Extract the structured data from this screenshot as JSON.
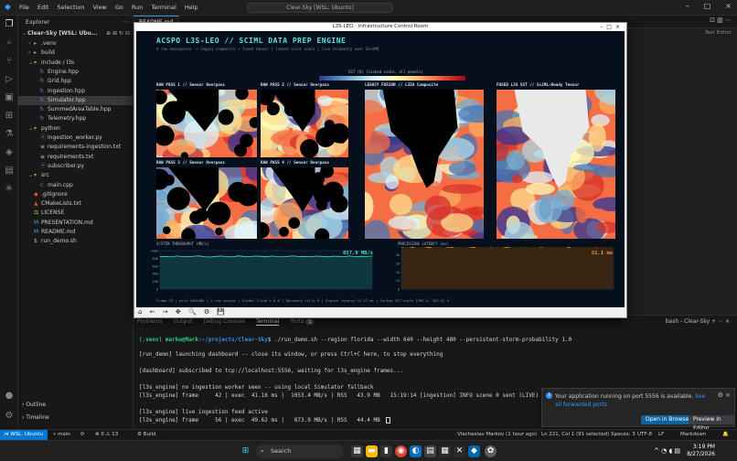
{
  "titlebar": {
    "menu": [
      "File",
      "Edit",
      "Selection",
      "View",
      "Go",
      "Run",
      "Terminal",
      "Help"
    ],
    "search": "Clear-Sky [WSL: Ubuntu]"
  },
  "sidebar": {
    "header": "Explorer",
    "root": "Clear-Sky [WSL: Ubu...",
    "items": [
      {
        "label": ".venv",
        "kind": "folder",
        "depth": 1
      },
      {
        "label": "build",
        "kind": "folder",
        "depth": 1
      },
      {
        "label": "include / l3s",
        "kind": "folder-open",
        "depth": 1
      },
      {
        "label": "Engine.hpp",
        "kind": "hpp",
        "depth": 2
      },
      {
        "label": "Grid.hpp",
        "kind": "hpp",
        "depth": 2
      },
      {
        "label": "Ingestion.hpp",
        "kind": "hpp",
        "depth": 2
      },
      {
        "label": "Simulator.hpp",
        "kind": "hpp",
        "depth": 2,
        "selected": true
      },
      {
        "label": "SummedAreaTable.hpp",
        "kind": "hpp",
        "depth": 2
      },
      {
        "label": "Telemetry.hpp",
        "kind": "hpp",
        "depth": 2
      },
      {
        "label": "python",
        "kind": "folder-open",
        "depth": 1
      },
      {
        "label": "ingestion_worker.py",
        "kind": "py",
        "depth": 2
      },
      {
        "label": "requirements-ingestion.txt",
        "kind": "txt",
        "depth": 2
      },
      {
        "label": "requirements.txt",
        "kind": "txt",
        "depth": 2
      },
      {
        "label": "subscriber.py",
        "kind": "py",
        "depth": 2
      },
      {
        "label": "src",
        "kind": "folder-open",
        "depth": 1
      },
      {
        "label": "main.cpp",
        "kind": "cpp",
        "depth": 2
      },
      {
        "label": ".gitignore",
        "kind": "git",
        "depth": 1
      },
      {
        "label": "CMakeLists.txt",
        "kind": "cmake",
        "depth": 1
      },
      {
        "label": "LICENSE",
        "kind": "license",
        "depth": 1
      },
      {
        "label": "PRESENTATION.md",
        "kind": "md",
        "depth": 1
      },
      {
        "label": "README.md",
        "kind": "md",
        "depth": 1
      },
      {
        "label": "run_demo.sh",
        "kind": "sh",
        "depth": 1
      }
    ],
    "outline": "Outline",
    "timeline": "Timeline"
  },
  "editor": {
    "tabs": [
      "README.md"
    ],
    "hint": "Text Editor"
  },
  "window": {
    "title": "L3S-LEO : Infrastructure Control Room",
    "dashboard_title": "ACSPO L3S-LEO  //  SCIML DATA PREP ENGINE",
    "dashboard_subtitle": "4 raw overpasses -> legacy composite + fused tensor  |  locked color scale  |  live telemetry over ZeroMQ",
    "colorbar_label": "SST (K)  (locked scale, all panels)",
    "panels": {
      "raw1": "RAW PASS 1  //  Sensor Overpass",
      "raw2": "RAW PASS 2  //  Sensor Overpass",
      "raw3": "RAW PASS 3  //  Sensor Overpass",
      "raw4": "RAW PASS 4  //  Sensor Overpass",
      "legacy": "LEGACY FUSION  //  L3ZA Composite",
      "fused": "FUSED L3S SST  //  SciML-Ready Tensor"
    },
    "throughput": {
      "title": "SYSTEM THROUGHPUT (MB/s)",
      "value": "857.9 MB/s",
      "color": "#3fe0c5"
    },
    "latency": {
      "title": "PROCESSING LATENCY (ms)",
      "value": "51.1 ms",
      "color": "#f5a142"
    },
    "footer": "Frame    53  |  grid 640x480  |  4 raw passes  |  Global Cloud %  0.0  |  Boundary fills  9  |  Engine latency  51.27 ms  |  locked SST scale [285.0, 305.0] K",
    "toolbar": "⌂ ← → ✥ 🔍 ⚙ 💾",
    "chart_data": [
      {
        "type": "area",
        "title": "SYSTEM THROUGHPUT (MB/s)",
        "yticks": [
          "1000",
          "800",
          "600",
          "400",
          "200",
          "0"
        ],
        "values": [
          842,
          851,
          836,
          860,
          848,
          839,
          855,
          862,
          844,
          833,
          850,
          857,
          846,
          838,
          861,
          849,
          843,
          856,
          852,
          840,
          858,
          847,
          835,
          853,
          859,
          845,
          850,
          842,
          857,
          849,
          839,
          855,
          851,
          846,
          860,
          843,
          852,
          848,
          857.9
        ],
        "ylim": [
          0,
          1000
        ]
      },
      {
        "type": "area",
        "title": "PROCESSING LATENCY (ms)",
        "yticks": [
          "40",
          "30",
          "20",
          "10",
          "0"
        ],
        "values": [
          49.2,
          50.1,
          48.7,
          51.3,
          49.9,
          48.5,
          50.6,
          51.8,
          49.4,
          48.9,
          50.2,
          51.0,
          49.6,
          48.8,
          50.9,
          51.4,
          49.3,
          50.4,
          49.8,
          48.6,
          50.7,
          51.2,
          49.5,
          50.0,
          51.6,
          49.1,
          50.3,
          49.7,
          51.1,
          50.5,
          48.9,
          50.8,
          49.9,
          51.3,
          50.2,
          49.4,
          50.6,
          51.0,
          51.1
        ],
        "ylim": [
          0,
          45
        ]
      }
    ]
  },
  "panel": {
    "tabs": [
      "Problems",
      "Output",
      "Debug Console",
      "Terminal",
      "Ports"
    ],
    "ports_badge": "1",
    "active_tab": "Terminal",
    "right": "bash - Clear-Sky  +  ⋯  ×",
    "terminal": [
      {
        "prompt_user": "(.venv) markw@Mark",
        "prompt_path": ":~/projects/Clear-Sky",
        "cmd": "$ ./run_demo.sh --region florida --width 640 --height 480 --persistent-storm-probability 1.0"
      },
      {
        "text": "[run_demo] launching dashboard -- close its window, or press Ctrl+C here, to stop everything"
      },
      {
        "text": ""
      },
      {
        "text": "[dashboard] subscribed to tcp://localhost:5556, waiting for l3s_engine frames..."
      },
      {
        "text": ""
      },
      {
        "text": "[l3s_engine] no ingestion worker seen -- using local Simulator fallback"
      },
      {
        "text": "[l3s_engine] frame     42 | exec  41.16 ms |  1053.4 MB/s | RSS   43.9 MB   15:19:14 [ingestion] INFO scene 0 sent (LIVE)"
      },
      {
        "text": ""
      },
      {
        "text": "[l3s_engine] live ingestion feed active"
      },
      {
        "text": "[l3s_engine] frame     56 | exec  49.62 ms |   873.9 MB/s | RSS   44.4 MB"
      }
    ]
  },
  "notification": {
    "message": "Your application running on port 5556 is available.",
    "link": "See all forwarded ports",
    "primary": "Open in Browser",
    "secondary": "Preview in Editor"
  },
  "statusbar": {
    "remote": "WSL: Ubuntu",
    "branch": "main",
    "sync": "⟳",
    "problems": "⊗ 0  ⚠ 13",
    "build": "⚙ Build",
    "author": "Vlacheslav Markov (1 hour ago)",
    "position": "Ln 221, Col 1 (91 selected)",
    "spaces": "Spaces: 3",
    "encoding": "UTF-8",
    "eol": "LF",
    "language": "Markdown"
  },
  "taskbar": {
    "search": "Search",
    "time": "3:19 PM",
    "date": "8/27/2026"
  },
  "colors": {
    "accent": "#0078d4",
    "prompt_green": "#23d18b",
    "prompt_blue": "#3b8eea",
    "dash_bg": "#06101d"
  }
}
